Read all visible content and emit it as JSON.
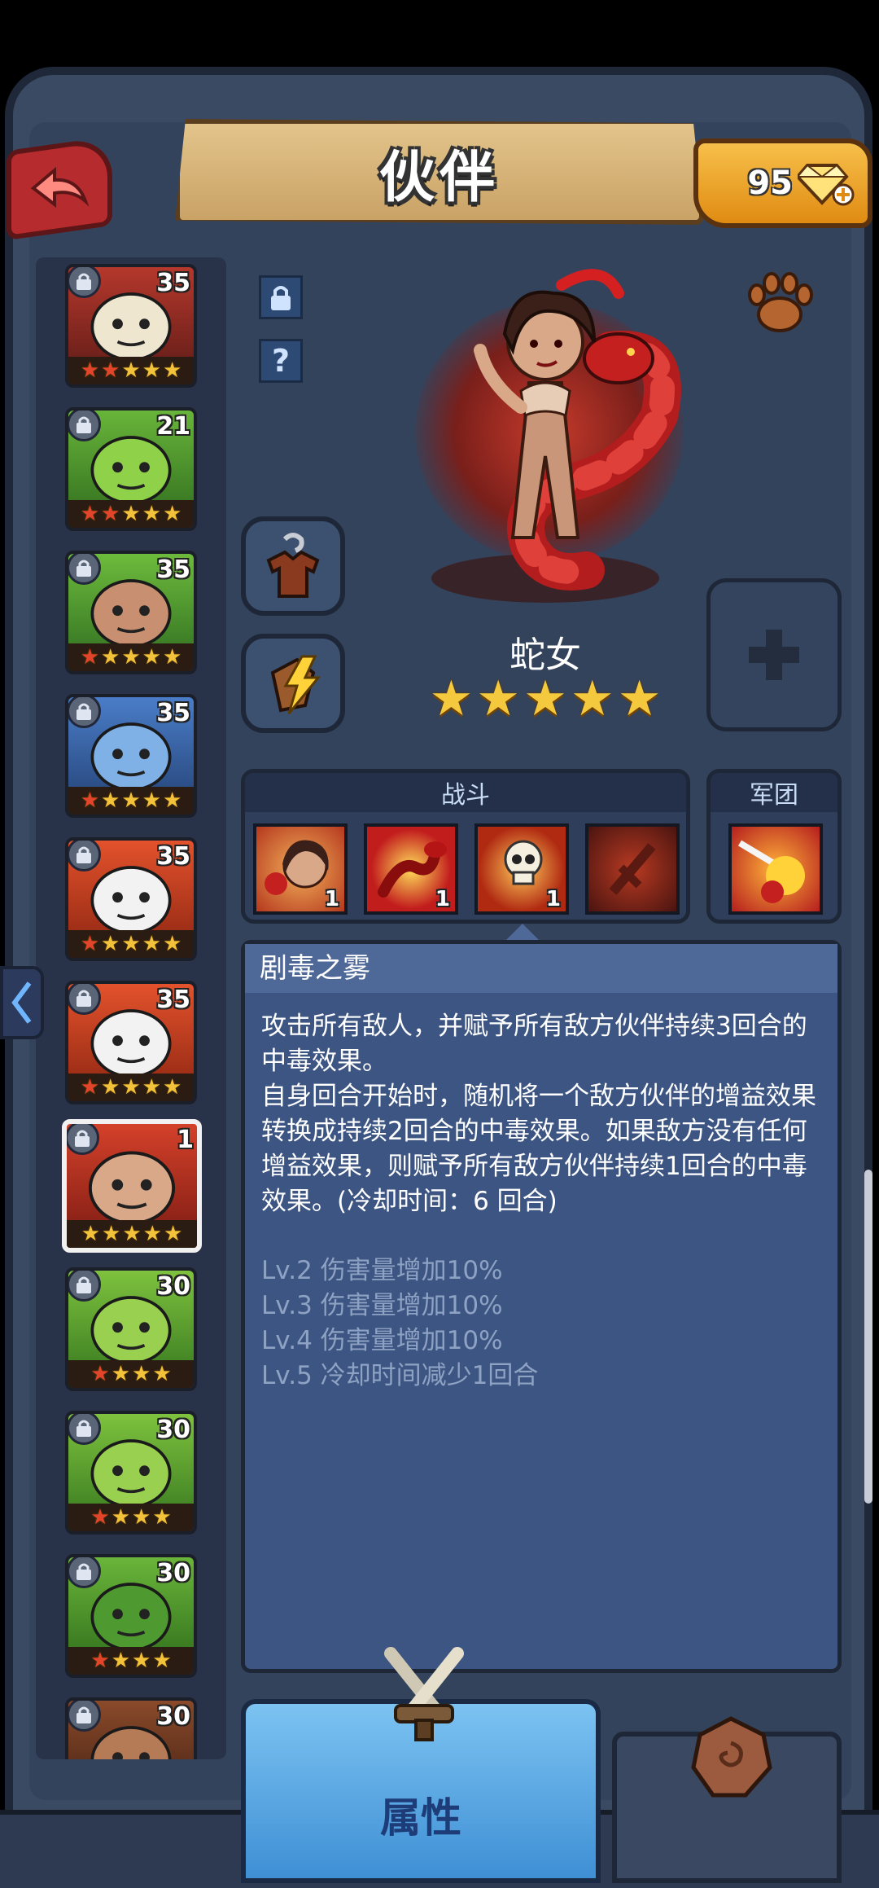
{
  "header": {
    "title": "伙伴",
    "gems": "95"
  },
  "hero_list": [
    {
      "level": "35",
      "stars": 5,
      "red_stars": 2,
      "theme": "skull-shaman"
    },
    {
      "level": "21",
      "stars": 5,
      "red_stars": 2,
      "theme": "goblin-ranger"
    },
    {
      "level": "35",
      "stars": 5,
      "red_stars": 1,
      "theme": "dwarf-warrior"
    },
    {
      "level": "35",
      "stars": 5,
      "red_stars": 1,
      "theme": "blue-troll"
    },
    {
      "level": "35",
      "stars": 5,
      "red_stars": 1,
      "theme": "panda"
    },
    {
      "level": "35",
      "stars": 5,
      "red_stars": 1,
      "theme": "panda"
    },
    {
      "level": "1",
      "stars": 5,
      "red_stars": 0,
      "theme": "snake-woman",
      "selected": true
    },
    {
      "level": "30",
      "stars": 4,
      "red_stars": 1,
      "theme": "orc"
    },
    {
      "level": "30",
      "stars": 4,
      "red_stars": 1,
      "theme": "boar-orc"
    },
    {
      "level": "30",
      "stars": 4,
      "red_stars": 1,
      "theme": "croc"
    },
    {
      "level": "30",
      "stars": 0,
      "red_stars": 0,
      "theme": "partial"
    }
  ],
  "hero": {
    "name": "蛇女",
    "stars": 5
  },
  "combat": {
    "title": "战斗",
    "skills": [
      {
        "num": "1",
        "theme": "portrait"
      },
      {
        "num": "1",
        "theme": "fire-snake"
      },
      {
        "num": "1",
        "theme": "skull"
      },
      {
        "num": "",
        "theme": "locked"
      }
    ]
  },
  "legion": {
    "title": "军团"
  },
  "skill_detail": {
    "name": "剧毒之雾",
    "lines": [
      "攻击所有敌人，并赋予所有敌方伙伴持续3回合的中毒效果。",
      "自身回合开始时，随机将一个敌方伙伴的增益效果转换成持续2回合的中毒效果。如果敌方没有任何增益效果，则赋予所有敌方伙伴持续1回合的中毒效果。(冷却时间：6 回合)"
    ],
    "levels": [
      "Lv.2 伤害量增加10%",
      "Lv.3 伤害量增加10%",
      "Lv.4 伤害量增加10%",
      "Lv.5 冷却时间减少1回合"
    ]
  },
  "tabs": {
    "active": "属性"
  },
  "icons": {
    "back": "back-arrow-icon",
    "gem": "diamond-icon",
    "lock": "lock-icon",
    "help": "question-icon",
    "paw": "paw-icon",
    "equip": "armor-icon",
    "skill": "gauntlet-icon",
    "plus": "plus-icon",
    "swords": "crossed-swords-icon",
    "rune": "rune-stone-icon"
  },
  "colors": {
    "accent_blue": "#4e6898",
    "star": "#f4c93e",
    "gem": "#f7c04a"
  }
}
